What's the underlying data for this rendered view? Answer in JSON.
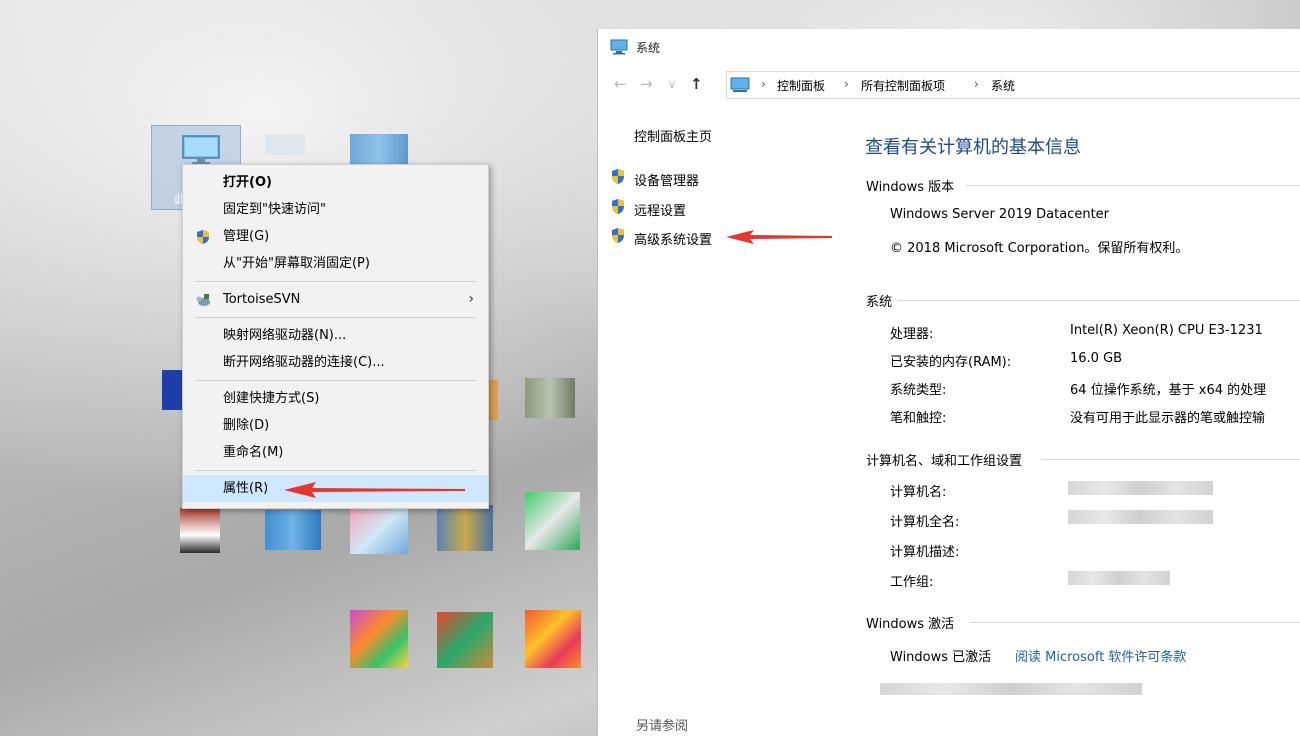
{
  "desktop": {
    "selected_icon_label": "此"
  },
  "context_menu": {
    "items": [
      {
        "label": "打开(O)",
        "bold": true
      },
      {
        "label": "固定到\"快速访问\""
      },
      {
        "label": "管理(G)",
        "icon": "uac-shield-icon"
      },
      {
        "label": "从\"开始\"屏幕取消固定(P)"
      },
      {
        "label": "TortoiseSVN",
        "icon": "tortoisesvn-icon",
        "submenu": true
      },
      {
        "label": "映射网络驱动器(N)..."
      },
      {
        "label": "断开网络驱动器的连接(C)..."
      },
      {
        "label": "创建快捷方式(S)"
      },
      {
        "label": "删除(D)"
      },
      {
        "label": "重命名(M)"
      },
      {
        "label": "属性(R)",
        "highlighted": true
      }
    ],
    "submenu_arrow": "›"
  },
  "window": {
    "title": "系统",
    "nav": {
      "back": "←",
      "forward": "→",
      "recent": "∨",
      "up": "↑"
    },
    "breadcrumb": [
      "控制面板",
      "所有控制面板项",
      "系统"
    ],
    "crumb_separator": "›",
    "sidebar": {
      "home": "控制面板主页",
      "links": [
        "设备管理器",
        "远程设置",
        "高级系统设置"
      ],
      "see_also": "另请参阅"
    },
    "main_title": "查看有关计算机的基本信息",
    "edition": {
      "header": "Windows 版本",
      "name": "Windows Server 2019 Datacenter",
      "copyright": "© 2018 Microsoft Corporation。保留所有权利。"
    },
    "system": {
      "header": "系统",
      "rows": [
        {
          "label": "处理器:",
          "value": "Intel(R) Xeon(R) CPU E3-1231"
        },
        {
          "label": "已安装的内存(RAM):",
          "value": "16.0 GB"
        },
        {
          "label": "系统类型:",
          "value": "64 位操作系统，基于 x64 的处理"
        },
        {
          "label": "笔和触控:",
          "value": "没有可用于此显示器的笔或触控输"
        }
      ]
    },
    "computer_name": {
      "header": "计算机名、域和工作组设置",
      "rows": [
        {
          "label": "计算机名:"
        },
        {
          "label": "计算机全名:"
        },
        {
          "label": "计算机描述:"
        },
        {
          "label": "工作组:"
        }
      ]
    },
    "activation": {
      "header": "Windows 激活",
      "status": "Windows 已激活",
      "license_link": "阅读 Microsoft 软件许可条款"
    }
  },
  "colors": {
    "link": "#1a5fb4",
    "title": "#1e4b8f",
    "arrow": "#e8342a",
    "menu_highlight": "#cde8ff"
  }
}
